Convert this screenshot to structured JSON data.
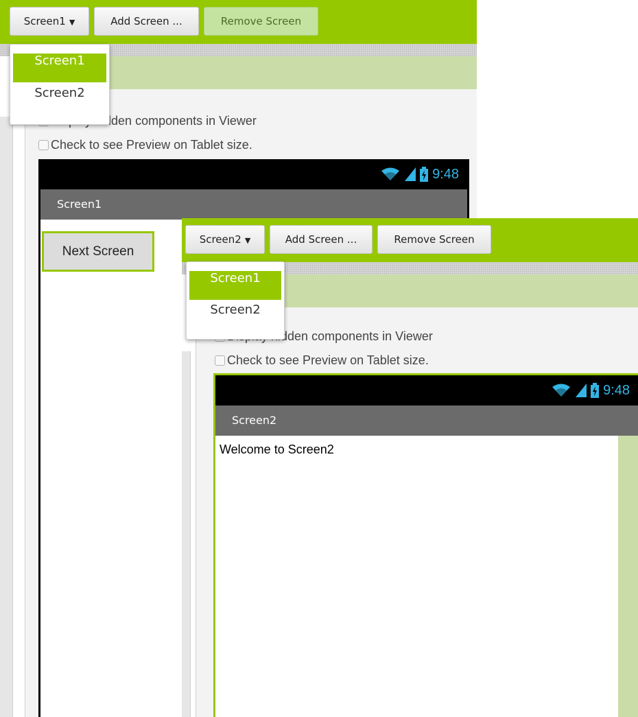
{
  "panel1": {
    "toolbar": {
      "screen_select": "Screen1",
      "add_screen": "Add Screen ...",
      "remove_screen": "Remove Screen"
    },
    "dropdown": {
      "items": [
        "Screen1",
        "Screen2"
      ],
      "selected": "Screen1"
    },
    "options": {
      "display_hidden": "Display hidden components in Viewer",
      "tablet_preview": "Check to see Preview on Tablet size."
    },
    "phone": {
      "time": "9:48",
      "title": "Screen1",
      "button_label": "Next Screen"
    }
  },
  "panel2": {
    "toolbar": {
      "screen_select": "Screen2",
      "add_screen": "Add Screen ...",
      "remove_screen": "Remove Screen"
    },
    "dropdown": {
      "items": [
        "Screen1",
        "Screen2"
      ],
      "selected": "Screen1"
    },
    "options": {
      "display_hidden": "Display hidden components in Viewer",
      "tablet_preview": "Check to see Preview on Tablet size."
    },
    "phone": {
      "time": "9:48",
      "title": "Screen2",
      "label_text": "Welcome to Screen2"
    }
  },
  "colors": {
    "accent": "#96c800",
    "header_light": "#cadda8",
    "title_bar": "#6b6b6b",
    "status_icon": "#33b5e5"
  },
  "icons": [
    "wifi-icon",
    "signal-icon",
    "battery-icon",
    "dropdown-caret-icon",
    "checkbox-icon"
  ]
}
